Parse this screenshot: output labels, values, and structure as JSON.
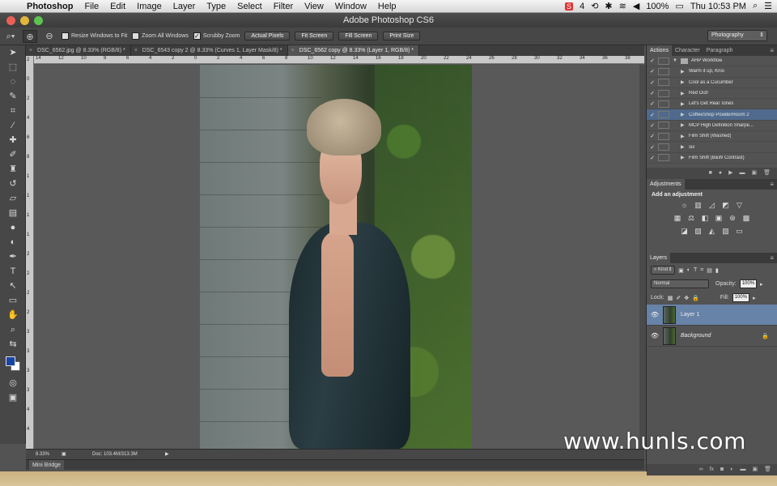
{
  "menubar": {
    "app_name": "Photoshop",
    "items": [
      "File",
      "Edit",
      "Image",
      "Layer",
      "Type",
      "Select",
      "Filter",
      "View",
      "Window",
      "Help"
    ],
    "status": {
      "badge": "S",
      "count": "4",
      "battery": "100%",
      "clock": "Thu 10:53 PM"
    }
  },
  "window": {
    "title": "Adobe Photoshop CS6"
  },
  "options_bar": {
    "checkboxes": [
      {
        "label": "Resize Windows to Fit",
        "checked": false
      },
      {
        "label": "Zoom All Windows",
        "checked": false
      },
      {
        "label": "Scrubby Zoom",
        "checked": true
      }
    ],
    "buttons": [
      "Actual Pixels",
      "Fit Screen",
      "Fill Screen",
      "Print Size"
    ],
    "workspace": "Photography"
  },
  "tabs": [
    {
      "label": "DSC_6562.jpg @ 8.33% (RGB/8) *",
      "active": false
    },
    {
      "label": "DSC_6543 copy 2 @ 8.33% (Curves 1, Layer Mask/8) *",
      "active": false
    },
    {
      "label": "DSC_6562 copy @ 8.33% (Layer 1, RGB/8) *",
      "active": true
    }
  ],
  "ruler": {
    "top": [
      "14",
      "12",
      "10",
      "8",
      "6",
      "4",
      "2",
      "0",
      "2",
      "4",
      "6",
      "8",
      "10",
      "12",
      "14",
      "16",
      "18",
      "20",
      "22",
      "24",
      "26",
      "28",
      "30",
      "32",
      "34",
      "36",
      "38"
    ],
    "left": [
      "2",
      "0",
      "2",
      "4",
      "6",
      "8",
      "1",
      "1",
      "1",
      "1",
      "2",
      "2",
      "2",
      "2",
      "3",
      "3",
      "3",
      "3",
      "4",
      "4"
    ]
  },
  "status_bar": {
    "zoom": "8.33%",
    "doc": "Doc: 103.4M/313.3M"
  },
  "mini_bridge": {
    "label": "Mini Bridge"
  },
  "panels": {
    "actions_tabs": [
      "Actions",
      "Character",
      "Paragraph"
    ],
    "actions": [
      {
        "name": "AHP Workflow",
        "folder": true,
        "selected": false
      },
      {
        "name": "Warm it up, Krisi",
        "folder": false,
        "selected": false
      },
      {
        "name": "Cool as a Cucumber",
        "folder": false,
        "selected": false
      },
      {
        "name": "Red Out!",
        "folder": false,
        "selected": false
      },
      {
        "name": "Let's Get Real Tones",
        "folder": false,
        "selected": false
      },
      {
        "name": "CoffeeShop PowderRoom 2",
        "folder": false,
        "selected": true
      },
      {
        "name": "MCP High Definition Sharpe...",
        "folder": false,
        "selected": false
      },
      {
        "name": "Film Shift (Washed)",
        "folder": false,
        "selected": false
      },
      {
        "name": "six",
        "folder": false,
        "selected": false
      },
      {
        "name": "Film Shift (B&W Contrast)",
        "folder": false,
        "selected": false
      }
    ],
    "adjustments_tab": "Adjustments",
    "adjustments_title": "Add an adjustment",
    "layers_tab": "Layers",
    "layers_filter": "Kind",
    "blend_mode": "Normal",
    "opacity_label": "Opacity:",
    "opacity": "100%",
    "lock_label": "Lock:",
    "fill_label": "Fill:",
    "fill": "100%",
    "layers": [
      {
        "name": "Layer 1",
        "selected": true,
        "locked": false
      },
      {
        "name": "Background",
        "selected": false,
        "locked": true
      }
    ]
  },
  "watermark": "www.hunls.com"
}
